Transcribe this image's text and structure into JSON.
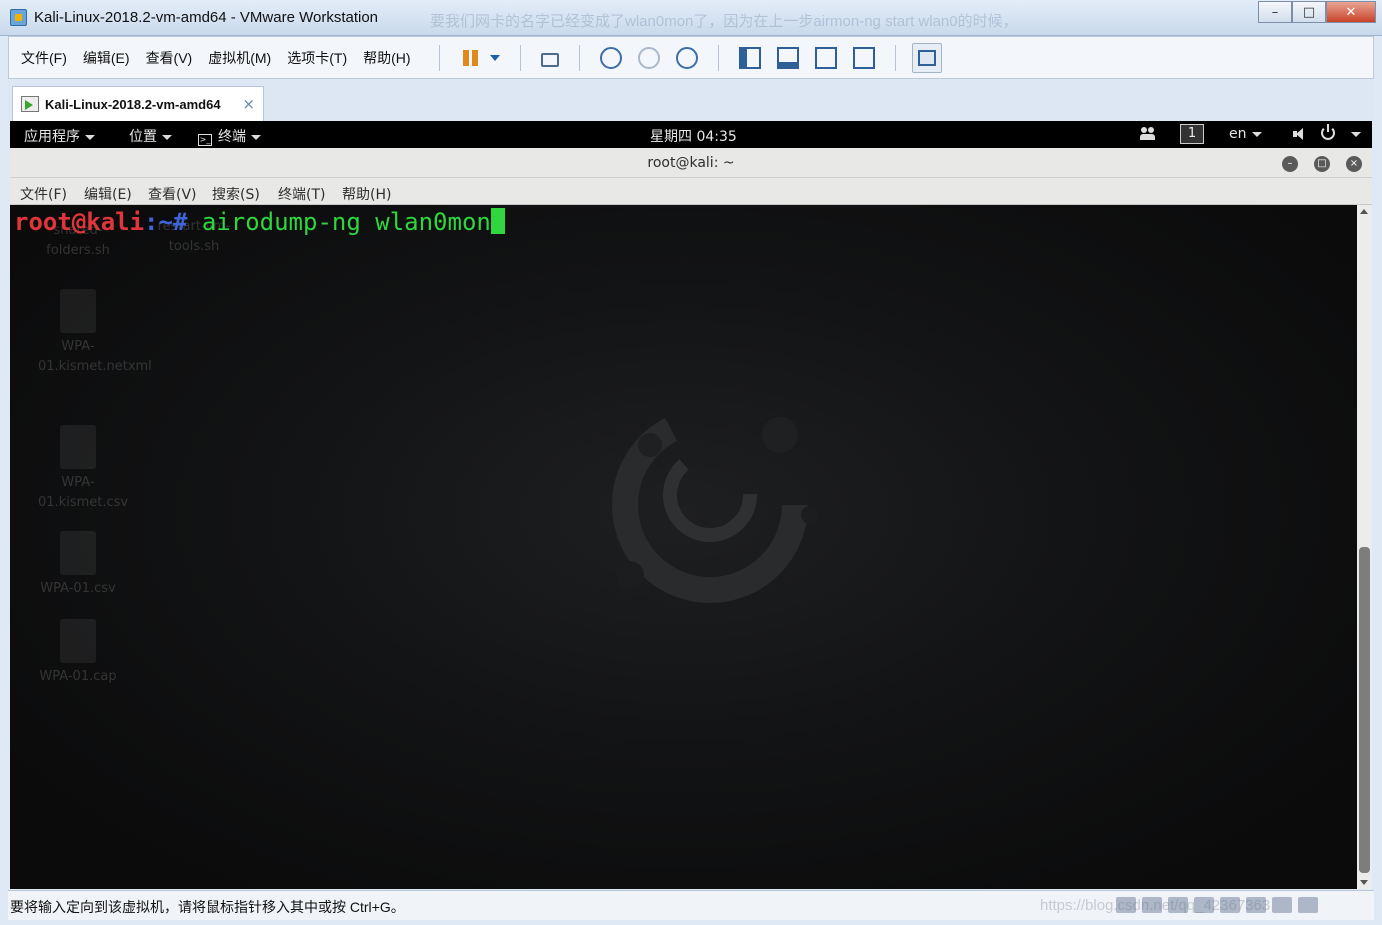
{
  "window": {
    "title": "Kali-Linux-2018.2-vm-amd64 - VMware Workstation",
    "overlay_text": "要我们网卡的名字已经变成了wlan0mon了，因为在上一步airmon-ng start wlan0的时候，",
    "minimize": "–",
    "maximize": "□",
    "close": "✕"
  },
  "menubar": {
    "items": [
      "文件(F)",
      "编辑(E)",
      "查看(V)",
      "虚拟机(M)",
      "选项卡(T)",
      "帮助(H)"
    ]
  },
  "toolbar": {
    "icons": [
      "pause-icon",
      "dropdown-icon",
      "network-icon",
      "snapshot-icon",
      "snapshot-revert-icon",
      "snapshot-manager-icon",
      "library-icon",
      "console-view-icon",
      "fullscreen-icon",
      "unity-icon",
      "thumbnail-view-icon"
    ]
  },
  "tab": {
    "label": "Kali-Linux-2018.2-vm-amd64",
    "close": "×"
  },
  "guest_topbar": {
    "applications": "应用程序",
    "places": "位置",
    "terminal": "终端",
    "clock": "星期四 04:35",
    "workspace": "1",
    "language": "en"
  },
  "terminal": {
    "title": "root@kali: ~",
    "menu": [
      "文件(F)",
      "编辑(E)",
      "查看(V)",
      "搜索(S)",
      "终端(T)",
      "帮助(H)"
    ],
    "prompt_user": "root@kali",
    "prompt_path": ":~#",
    "command": " airodump-ng wlan0mon",
    "minimize": "–",
    "maximize": "□",
    "close": "×"
  },
  "desktop_icons": [
    {
      "label": "shared-folders.sh"
    },
    {
      "label": "restart-vm-tools.sh"
    },
    {
      "label": "WPA-01.kismet.netxml"
    },
    {
      "label": "WPA-01.kismet.csv"
    },
    {
      "label": "WPA-01.csv"
    },
    {
      "label": "WPA-01.cap"
    }
  ],
  "statusbar": {
    "message": "要将输入定向到该虚拟机，请将鼠标指针移入其中或按 Ctrl+G。",
    "watermark": "https://blog.csdn.net/qq_42367363"
  },
  "colors": {
    "prompt_user": "#e0363b",
    "prompt_path": "#3f63d9",
    "command": "#2fd63d",
    "accent_orange": "#e08a1e",
    "toolbar_blue": "#2e5f99"
  }
}
